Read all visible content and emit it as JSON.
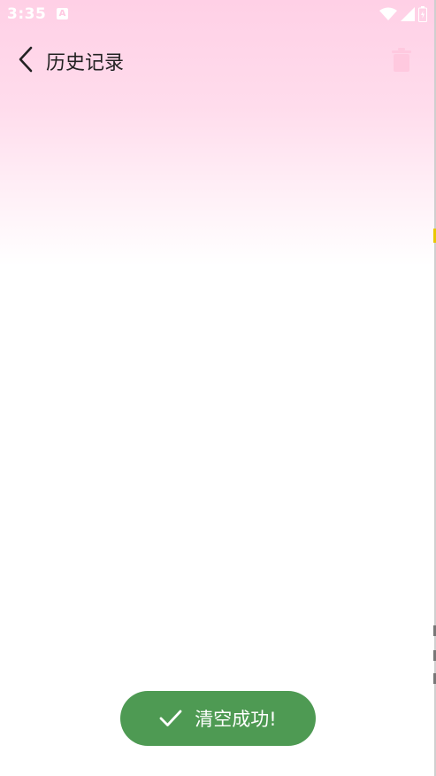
{
  "status_bar": {
    "time": "3:35",
    "notification_badge": "A",
    "icons": [
      "wifi-icon",
      "signal-icon",
      "battery-icon"
    ]
  },
  "app_bar": {
    "title": "历史记录",
    "back_icon": "chevron-left-icon",
    "action_icon": "trash-icon"
  },
  "toast": {
    "message": "清空成功!",
    "icon": "check-icon",
    "color": "#4e9a53"
  },
  "colors": {
    "gradient_top": "#ffd0e6",
    "background": "#ffffff"
  }
}
